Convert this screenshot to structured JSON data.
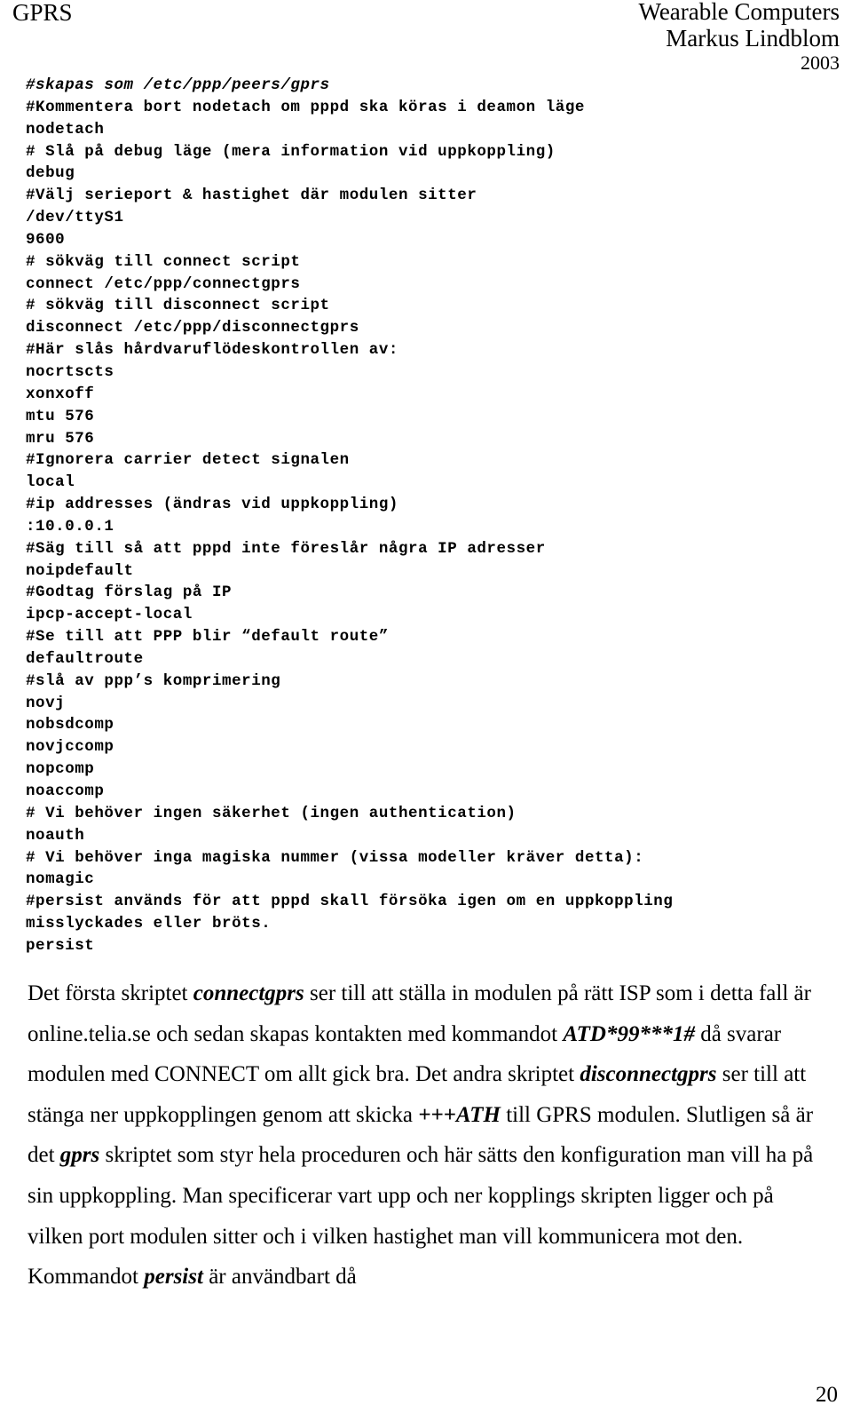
{
  "header": {
    "left_title": "GPRS",
    "right_title": "Wearable Computers",
    "author": "Markus Lindblom",
    "year": "2003"
  },
  "code_listing": {
    "lines": [
      {
        "text": "#skapas som /etc/ppp/peers/gprs",
        "style": "italic"
      },
      {
        "text": "#Kommentera bort nodetach om pppd ska köras i deamon läge",
        "style": "normal"
      },
      {
        "text": "nodetach",
        "style": "normal"
      },
      {
        "text": "# Slå på debug läge (mera information vid uppkoppling)",
        "style": "normal"
      },
      {
        "text": "debug",
        "style": "normal"
      },
      {
        "text": "#Välj serieport & hastighet där modulen sitter",
        "style": "normal"
      },
      {
        "text": "/dev/ttyS1",
        "style": "normal"
      },
      {
        "text": "9600",
        "style": "normal"
      },
      {
        "text": "# sökväg till connect script",
        "style": "normal"
      },
      {
        "text": "connect /etc/ppp/connectgprs",
        "style": "normal"
      },
      {
        "text": "# sökväg till disconnect script",
        "style": "normal"
      },
      {
        "text": "disconnect /etc/ppp/disconnectgprs",
        "style": "normal"
      },
      {
        "text": "#Här slås hårdvaruflödeskontrollen av:",
        "style": "normal"
      },
      {
        "text": "nocrtscts",
        "style": "normal"
      },
      {
        "text": "xonxoff",
        "style": "normal"
      },
      {
        "text": "mtu 576",
        "style": "normal"
      },
      {
        "text": "mru 576",
        "style": "normal"
      },
      {
        "text": "#Ignorera carrier detect signalen",
        "style": "normal"
      },
      {
        "text": "local",
        "style": "normal"
      },
      {
        "text": "#ip addresses (ändras vid uppkoppling)",
        "style": "normal"
      },
      {
        "text": ":10.0.0.1",
        "style": "normal"
      },
      {
        "text": "#Säg till så att pppd inte föreslår några IP adresser",
        "style": "normal"
      },
      {
        "text": "noipdefault",
        "style": "normal"
      },
      {
        "text": "#Godtag förslag på IP",
        "style": "normal"
      },
      {
        "text": "ipcp-accept-local",
        "style": "normal"
      },
      {
        "text": "#Se till att PPP blir “default route”",
        "style": "normal"
      },
      {
        "text": "defaultroute",
        "style": "normal"
      },
      {
        "text": "#slå av ppp’s komprimering",
        "style": "normal"
      },
      {
        "text": "novj",
        "style": "normal"
      },
      {
        "text": "nobsdcomp",
        "style": "normal"
      },
      {
        "text": "novjccomp",
        "style": "normal"
      },
      {
        "text": "nopcomp",
        "style": "normal"
      },
      {
        "text": "noaccomp",
        "style": "normal"
      },
      {
        "text": "# Vi behöver ingen säkerhet (ingen authentication)",
        "style": "normal"
      },
      {
        "text": "noauth",
        "style": "normal"
      },
      {
        "text": "# Vi behöver inga magiska nummer (vissa modeller kräver detta):",
        "style": "normal"
      },
      {
        "text": "nomagic",
        "style": "normal"
      },
      {
        "text": "#persist används för att pppd skall försöka igen om en uppkoppling",
        "style": "normal"
      },
      {
        "text": "misslyckades eller bröts.",
        "style": "normal"
      },
      {
        "text": "persist",
        "style": "normal"
      }
    ]
  },
  "body": {
    "paragraph_runs": [
      {
        "text": "Det första skriptet ",
        "emphasis": false
      },
      {
        "text": "connectgprs",
        "emphasis": true
      },
      {
        "text": " ser till att ställa in modulen på rätt ISP som i detta fall är online.telia.se och sedan skapas kontakten med kommandot ",
        "emphasis": false
      },
      {
        "text": "ATD*99***1#",
        "emphasis": true
      },
      {
        "text": " då svarar modulen med CONNECT om allt gick bra. Det andra skriptet ",
        "emphasis": false
      },
      {
        "text": "disconnectgprs",
        "emphasis": true
      },
      {
        "text": " ser till att stänga ner uppkopplingen genom att skicka ",
        "emphasis": false
      },
      {
        "text": "+++ATH",
        "emphasis": true
      },
      {
        "text": " till GPRS modulen. Slutligen så är det ",
        "emphasis": false
      },
      {
        "text": "gprs",
        "emphasis": true
      },
      {
        "text": " skriptet som styr hela proceduren och här sätts den konfiguration man vill ha på sin uppkoppling. Man specificerar vart upp och ner kopplings skripten ligger och på vilken port modulen sitter och i vilken hastighet man vill kommunicera mot den. Kommandot ",
        "emphasis": false
      },
      {
        "text": "persist",
        "emphasis": true
      },
      {
        "text": " är användbart då",
        "emphasis": false
      }
    ]
  },
  "footer": {
    "page_number": "20"
  }
}
